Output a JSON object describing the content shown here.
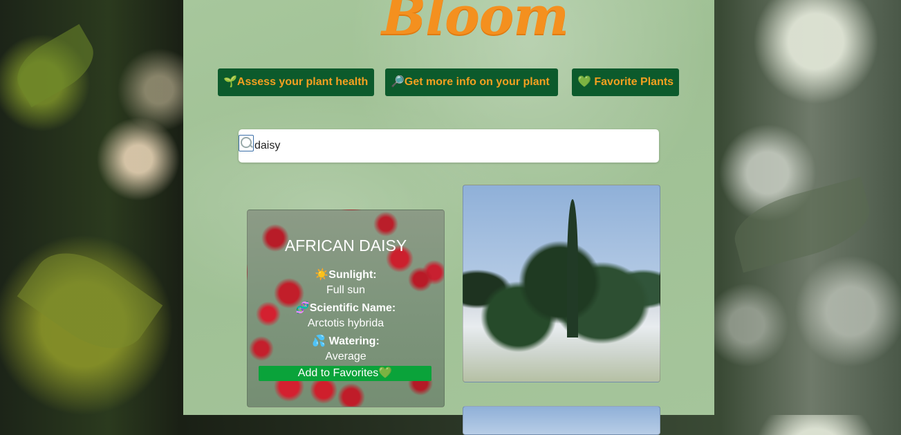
{
  "app": {
    "logo_text": "Bloom"
  },
  "nav": {
    "assess": "🌱Assess your plant health",
    "info": "🔎Get more info on your plant",
    "favorites": "💚 Favorite Plants"
  },
  "search": {
    "value": "daisy",
    "icon": "search-icon"
  },
  "results": [
    {
      "title": "AFRICAN DAISY",
      "sunlight_label": "☀️Sunlight:",
      "sunlight": "Full sun",
      "scientific_label": "🧬Scientific Name:",
      "scientific": "Arctotis hybrida",
      "watering_label": "💦 Watering:",
      "watering": "Average",
      "favorite_label": "Add to Favorites💚"
    }
  ],
  "colors": {
    "accent": "#f4901f",
    "nav_bg": "#0c5a2c",
    "fav_btn": "#0aa33a",
    "panel": "#a7c79c"
  }
}
